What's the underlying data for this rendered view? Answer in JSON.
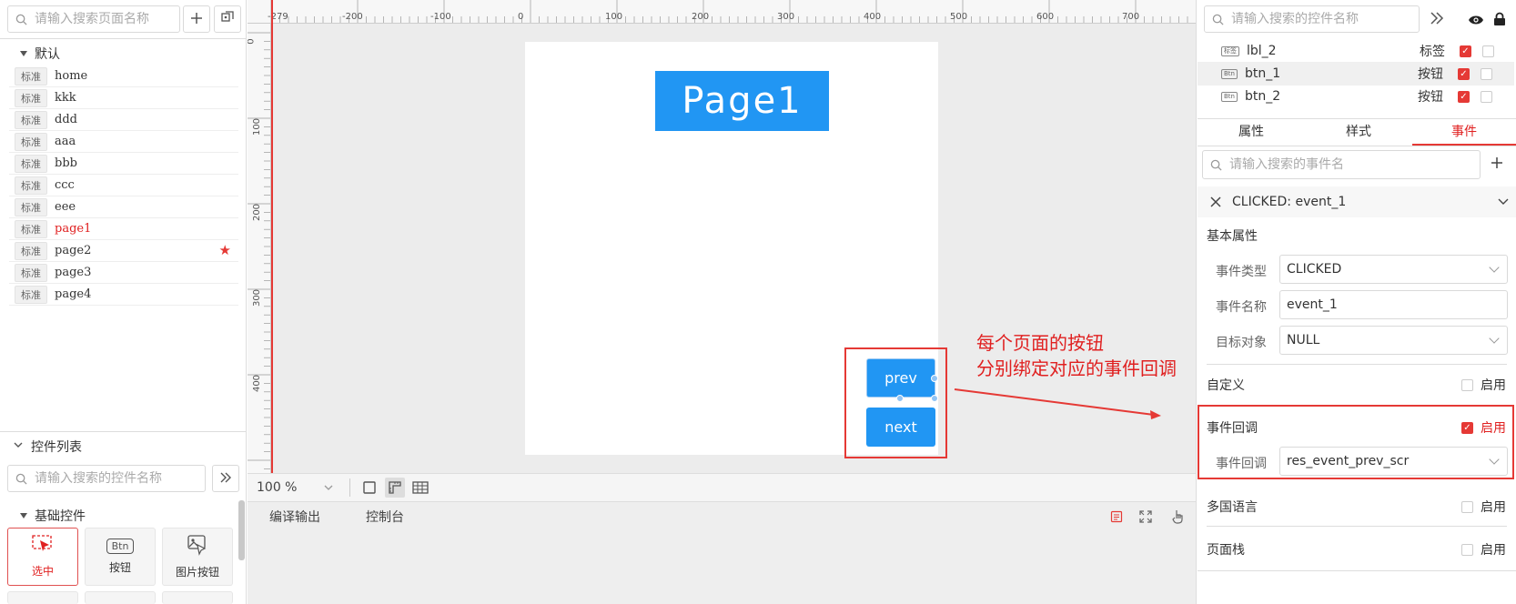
{
  "left_panel": {
    "page_search_placeholder": "请输入搜索页面名称",
    "group_name": "默认",
    "pages": [
      {
        "tag": "标准",
        "name": "home",
        "active": false,
        "starred": false
      },
      {
        "tag": "标准",
        "name": "kkk",
        "active": false,
        "starred": false
      },
      {
        "tag": "标准",
        "name": "ddd",
        "active": false,
        "starred": false
      },
      {
        "tag": "标准",
        "name": "aaa",
        "active": false,
        "starred": false
      },
      {
        "tag": "标准",
        "name": "bbb",
        "active": false,
        "starred": false
      },
      {
        "tag": "标准",
        "name": "ccc",
        "active": false,
        "starred": false
      },
      {
        "tag": "标准",
        "name": "eee",
        "active": false,
        "starred": false
      },
      {
        "tag": "标准",
        "name": "page1",
        "active": true,
        "starred": false
      },
      {
        "tag": "标准",
        "name": "page2",
        "active": false,
        "starred": true
      },
      {
        "tag": "标准",
        "name": "page3",
        "active": false,
        "starred": false
      },
      {
        "tag": "标准",
        "name": "page4",
        "active": false,
        "starred": false
      }
    ],
    "widget_list_title": "控件列表",
    "widget_search_placeholder": "请输入搜索的控件名称",
    "basic_group": "基础控件",
    "widgets": [
      {
        "label": "选中",
        "icon": "select-icon",
        "selected": true
      },
      {
        "label": "按钮",
        "icon": "btn-icon",
        "chip": "Btn",
        "selected": false
      },
      {
        "label": "图片按钮",
        "icon": "image-button-icon",
        "selected": false
      }
    ]
  },
  "canvas": {
    "ruler_top": [
      "-279",
      "-200",
      "-100",
      "0",
      "100",
      "200",
      "300",
      "400",
      "500",
      "600",
      "700"
    ],
    "ruler_left": [
      "0",
      "100",
      "200",
      "300",
      "400"
    ],
    "page_title": "Page1",
    "prev_label": "prev",
    "next_label": "next",
    "annotation_line1": "每个页面的按钮",
    "annotation_line2": "分别绑定对应的事件回调",
    "zoom": "100 %"
  },
  "bottom_tabs": {
    "compile_output": "编译输出",
    "console": "控制台"
  },
  "right_panel": {
    "widget_search_placeholder": "请输入搜索的控件名称",
    "layers": [
      {
        "chip": "标签",
        "name": "lbl_2",
        "type": "标签",
        "visible": true,
        "locked": false,
        "highlight": false
      },
      {
        "chip": "Btn",
        "name": "btn_1",
        "type": "按钮",
        "visible": true,
        "locked": false,
        "highlight": true
      },
      {
        "chip": "Btn",
        "name": "btn_2",
        "type": "按钮",
        "visible": true,
        "locked": false,
        "highlight": false
      }
    ],
    "tabs": [
      "属性",
      "样式",
      "事件"
    ],
    "active_tab": "事件",
    "event_search_placeholder": "请输入搜索的事件名",
    "event_title": "CLICKED: event_1",
    "basic_props": "基本属性",
    "event_type_label": "事件类型",
    "event_type_value": "CLICKED",
    "event_name_label": "事件名称",
    "event_name_value": "event_1",
    "target_label": "目标对象",
    "target_value": "NULL",
    "custom_label": "自定义",
    "enable_label": "启用",
    "callback_section": "事件回调",
    "callback_label": "事件回调",
    "callback_value": "res_event_prev_scr",
    "i18n_label": "多国语言",
    "page_stack_label": "页面栈",
    "custom_enabled": false,
    "callback_enabled": true,
    "i18n_enabled": false,
    "page_stack_enabled": false
  },
  "colors": {
    "accent_red": "#e53935",
    "button_blue": "#2196f3"
  }
}
